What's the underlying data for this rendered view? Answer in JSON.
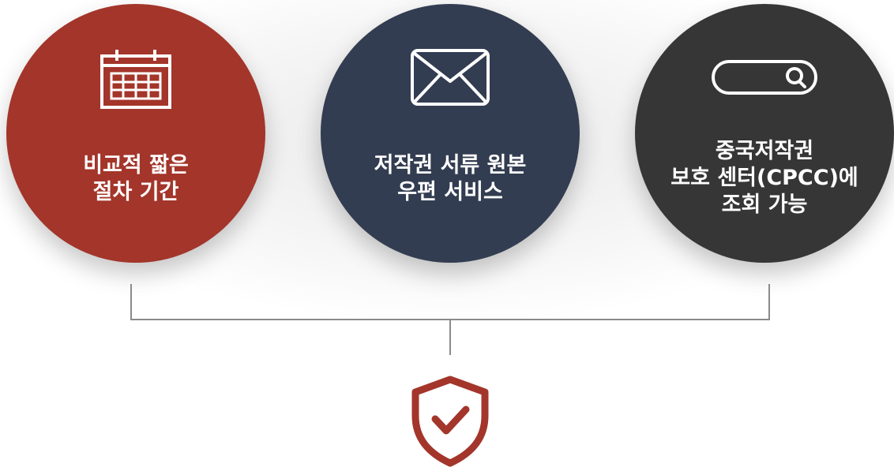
{
  "colors": {
    "red": "#a3352a",
    "navy": "#333d51",
    "charcoal": "#363636",
    "line": "#8a8a8a"
  },
  "features": [
    {
      "icon": "calendar-icon",
      "lines": [
        "비교적 짧은",
        "절차 기간"
      ]
    },
    {
      "icon": "envelope-icon",
      "lines": [
        "저작권 서류 원본",
        "우편 서비스"
      ]
    },
    {
      "icon": "search-bar-icon",
      "lines": [
        "중국저작권",
        "보호 센터(CPCC)에",
        "조회 가능"
      ]
    }
  ],
  "result_icon": "shield-check-icon"
}
